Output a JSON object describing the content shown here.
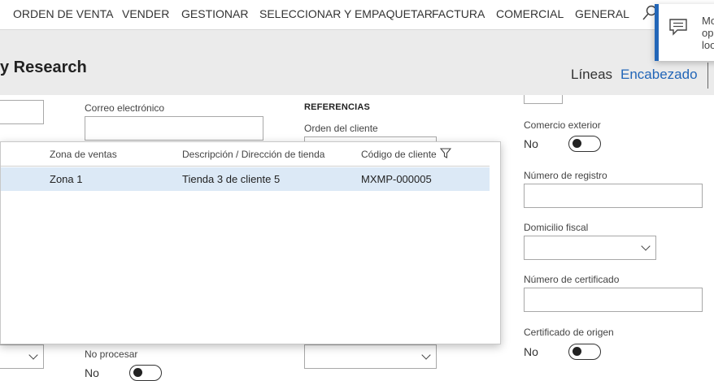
{
  "menu": {
    "items": [
      "ORDEN DE VENTA",
      "VENDER",
      "GESTIONAR",
      "SELECCIONAR Y EMPAQUETAR",
      "FACTURA",
      "COMERCIAL",
      "GENERAL"
    ]
  },
  "header": {
    "title": "y Research",
    "tabs": {
      "lineas": "Líneas",
      "encabezado": "Encabezado"
    }
  },
  "toast": {
    "text": "Mo ope loo"
  },
  "form": {
    "email_label": "Correo electrónico",
    "email_value": "",
    "referencias_heading": "REFERENCIAS",
    "orden_cliente_label": "Orden del cliente",
    "comercio_exterior_label": "Comercio exterior",
    "comercio_exterior_value": "No",
    "numero_registro_label": "Número de registro",
    "domicilio_fiscal_label": "Domicilio fiscal",
    "numero_certificado_label": "Número de certificado",
    "certificado_origen_label": "Certificado de origen",
    "certificado_origen_value": "No",
    "no_procesar_label": "No procesar",
    "no_procesar_value": "No"
  },
  "lookup": {
    "columns": [
      "Zona de ventas",
      "Descripción / Dirección de tienda",
      "Código de cliente"
    ],
    "rows": [
      {
        "zona": "Zona 1",
        "descripcion": "Tienda 3 de cliente 5",
        "codigo": "MXMP-000005"
      }
    ]
  },
  "colors": {
    "accent": "#2266b8",
    "selected_row": "#dce9f6",
    "header_band": "#ebebeb"
  }
}
